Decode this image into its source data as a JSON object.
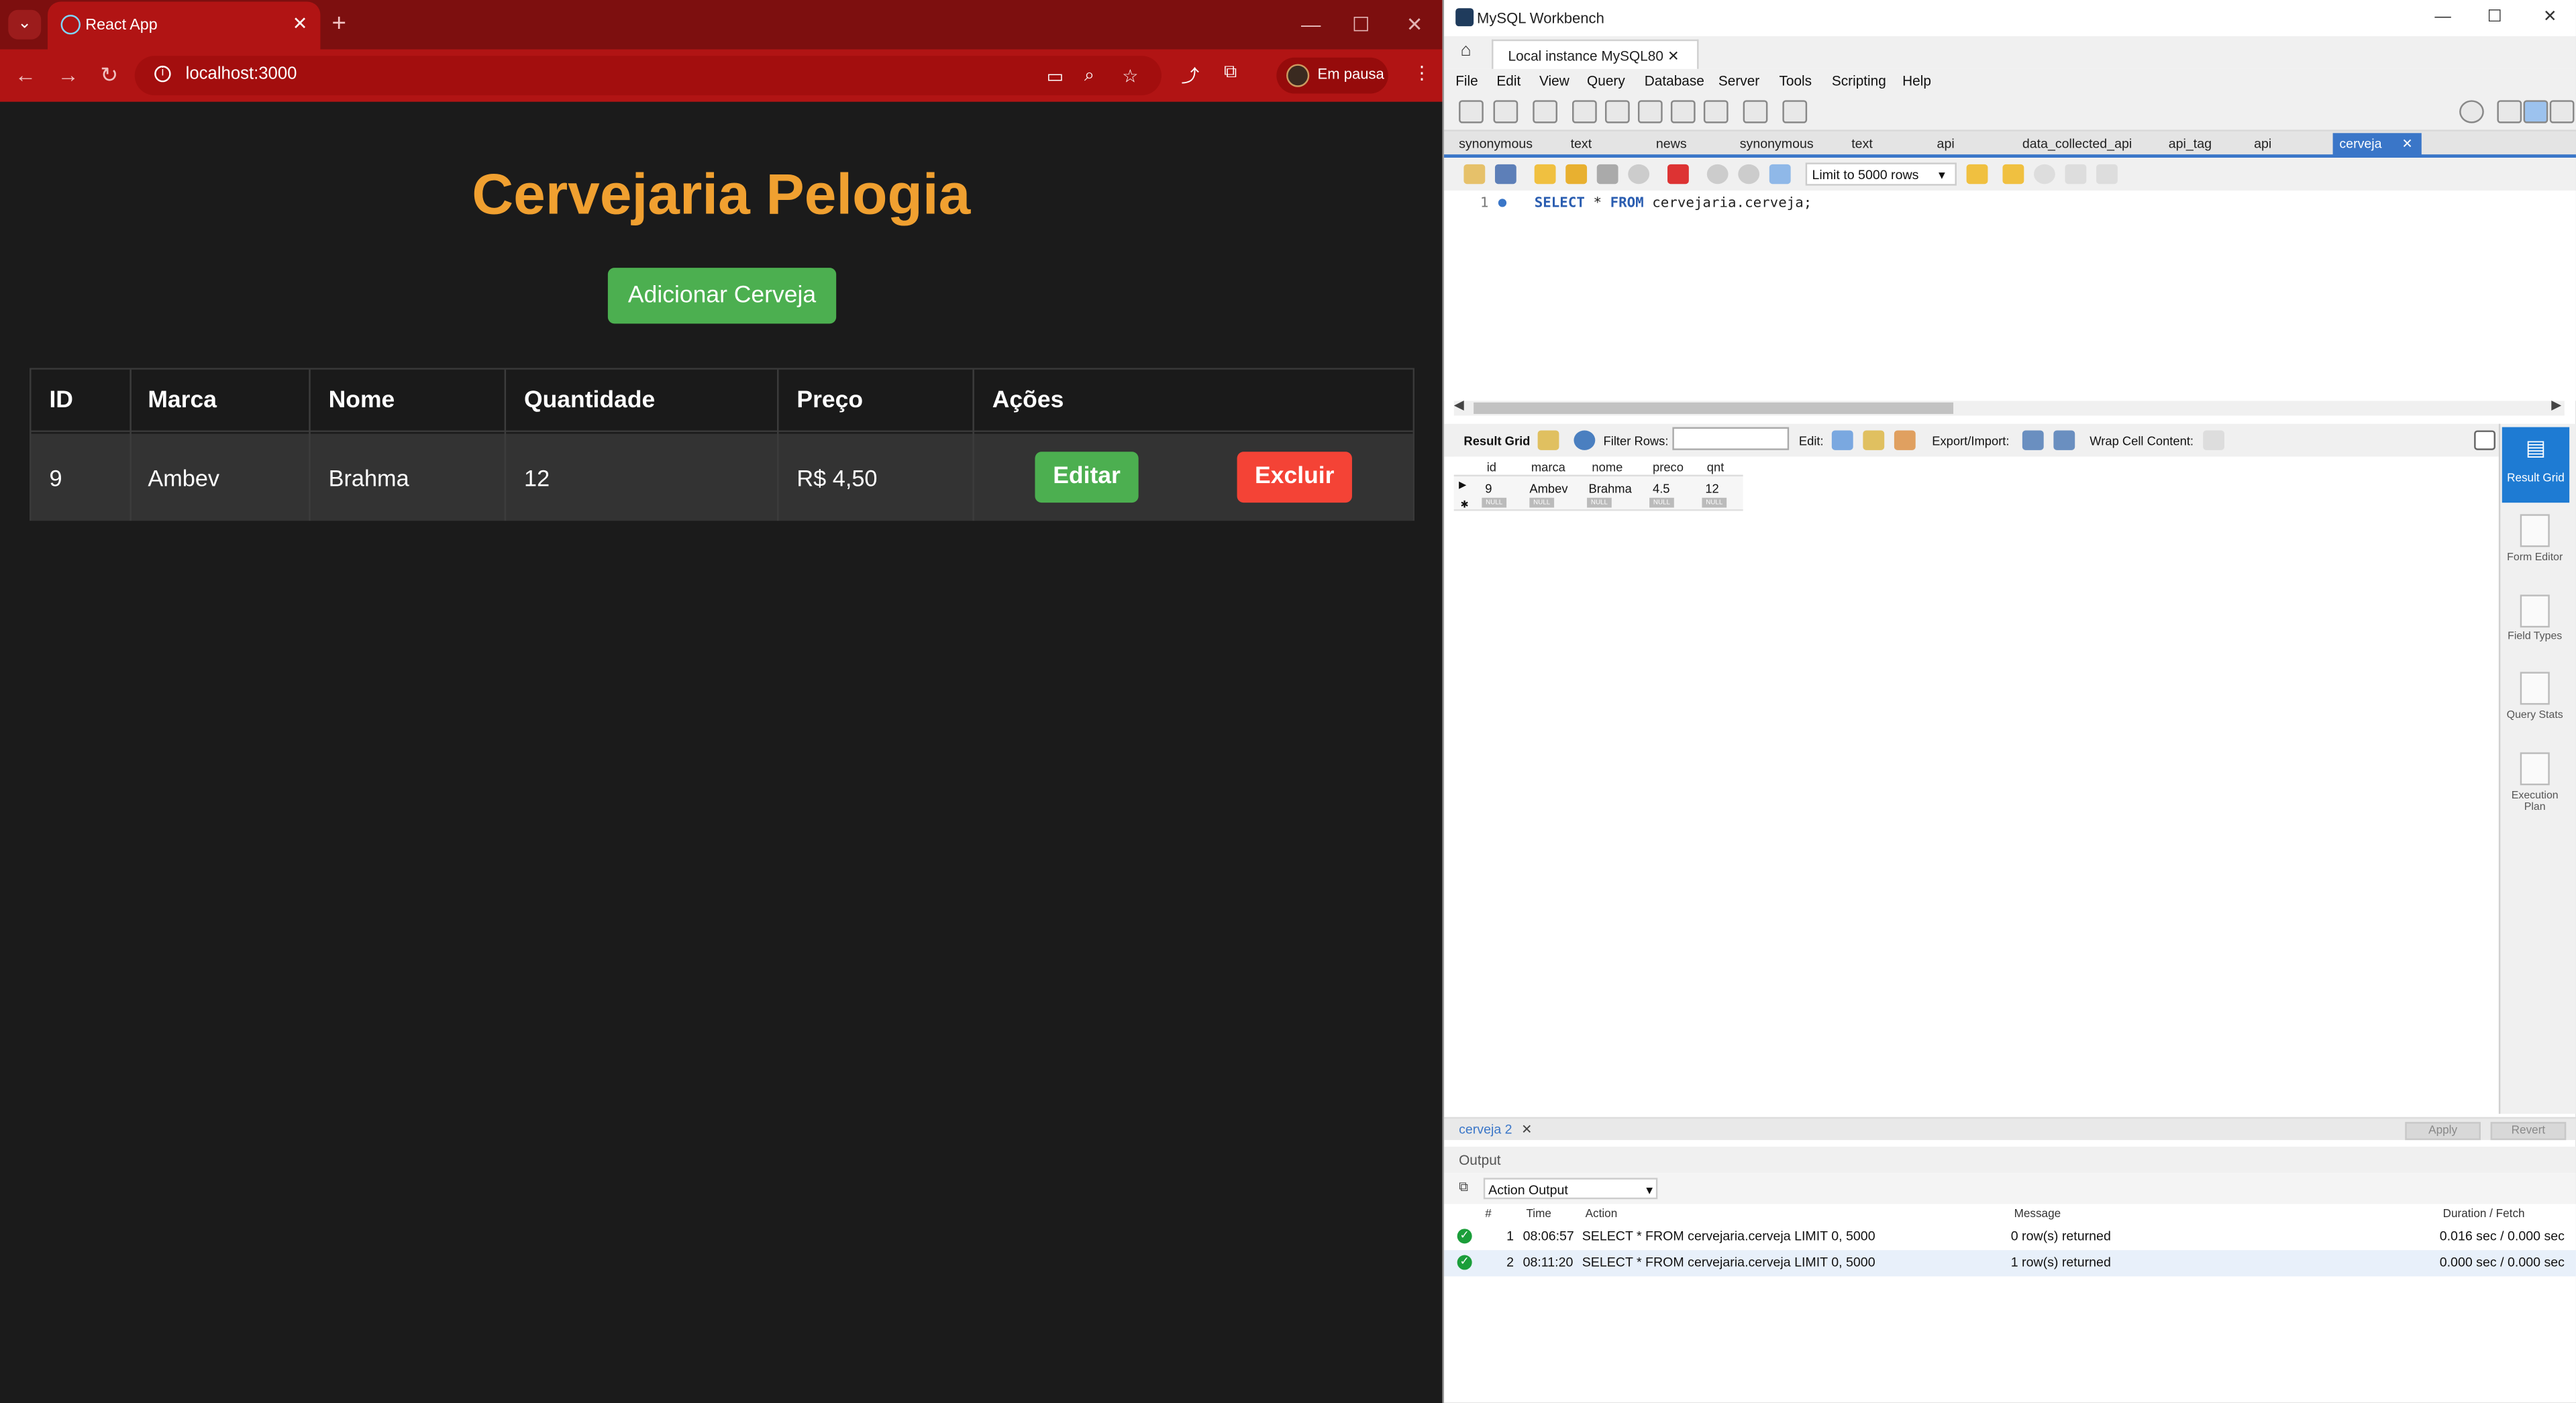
{
  "chrome": {
    "tab_title": "React App",
    "tab_close": "✕",
    "new_tab": "+",
    "url": "localhost:3000",
    "profile_label": "Em pausa",
    "window_controls": [
      "—",
      "☐",
      "✕"
    ]
  },
  "app": {
    "heading": "Cervejaria Pelogia",
    "add_button": "Adicionar Cerveja",
    "columns": [
      "ID",
      "Marca",
      "Nome",
      "Quantidade",
      "Preço",
      "Ações"
    ],
    "rows": [
      {
        "id": "9",
        "marca": "Ambev",
        "nome": "Brahma",
        "quantidade": "12",
        "preco": "R$ 4,50",
        "edit_label": "Editar",
        "delete_label": "Excluir"
      }
    ]
  },
  "workbench": {
    "window_title": "MySQL Workbench",
    "connection_tab": "Local instance MySQL80",
    "menu": [
      "File",
      "Edit",
      "View",
      "Query",
      "Database",
      "Server",
      "Tools",
      "Scripting",
      "Help"
    ],
    "query_tabs": [
      "synonymous",
      "text",
      "news",
      "synonymous",
      "text",
      "api",
      "data_collected_api",
      "api_tag",
      "api"
    ],
    "active_tab": "cerveja",
    "limit_label": "Limit to 5000 rows",
    "editor": {
      "line_number": "1",
      "kw_select": "SELECT",
      "star": "*",
      "kw_from": "FROM",
      "rest": "cervejaria.cerveja;"
    },
    "result_bar": {
      "result_grid": "Result Grid",
      "filter_rows": "Filter Rows:",
      "edit": "Edit:",
      "export_import": "Export/Import:",
      "wrap": "Wrap Cell Content:"
    },
    "grid": {
      "columns": [
        "id",
        "marca",
        "nome",
        "preco",
        "qnt"
      ],
      "row": [
        "9",
        "Ambev",
        "Brahma",
        "4.5",
        "12"
      ],
      "null_label": "NULL"
    },
    "side_panel": [
      "Result Grid",
      "Form Editor",
      "Field Types",
      "Query Stats",
      "Execution Plan"
    ],
    "bottom_tab": "cerveja 2",
    "apply": "Apply",
    "revert": "Revert",
    "output_label": "Output",
    "output_selector": "Action Output",
    "output_columns": [
      "#",
      "Time",
      "Action",
      "Message",
      "Duration / Fetch"
    ],
    "output_rows": [
      {
        "n": "1",
        "time": "08:06:57",
        "action": "SELECT * FROM cervejaria.cerveja LIMIT 0, 5000",
        "message": "0 row(s) returned",
        "duration": "0.016 sec / 0.000 sec"
      },
      {
        "n": "2",
        "time": "08:11:20",
        "action": "SELECT * FROM cervejaria.cerveja LIMIT 0, 5000",
        "message": "1 row(s) returned",
        "duration": "0.000 sec / 0.000 sec"
      }
    ]
  },
  "colors": {
    "chrome_red": "#b11414",
    "heading_orange": "#f0a030",
    "green": "#4caf50",
    "red": "#f44336",
    "wb_blue": "#3a76c8"
  }
}
